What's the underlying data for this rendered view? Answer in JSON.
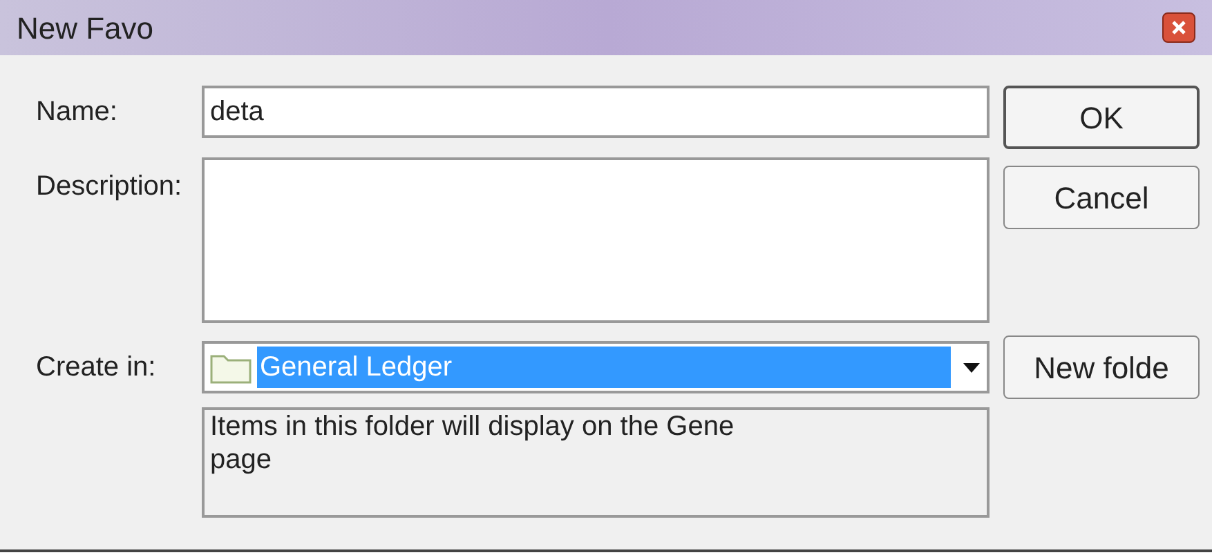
{
  "window": {
    "title": "New Favo"
  },
  "name_field": {
    "label": "Name:",
    "value": "deta"
  },
  "description_field": {
    "label": "Description:"
  },
  "create_in": {
    "label": "Create in:",
    "value": "General Ledger"
  },
  "folder_note": {
    "text": "Items in this folder will display on the Gene",
    "line_2": "page"
  },
  "buttons": [
    {
      "label": "OK",
      "kind": "default"
    },
    {
      "label": "Cancel",
      "kind": "normal"
    },
    {
      "label": "New folde",
      "kind": "normal"
    }
  ]
}
